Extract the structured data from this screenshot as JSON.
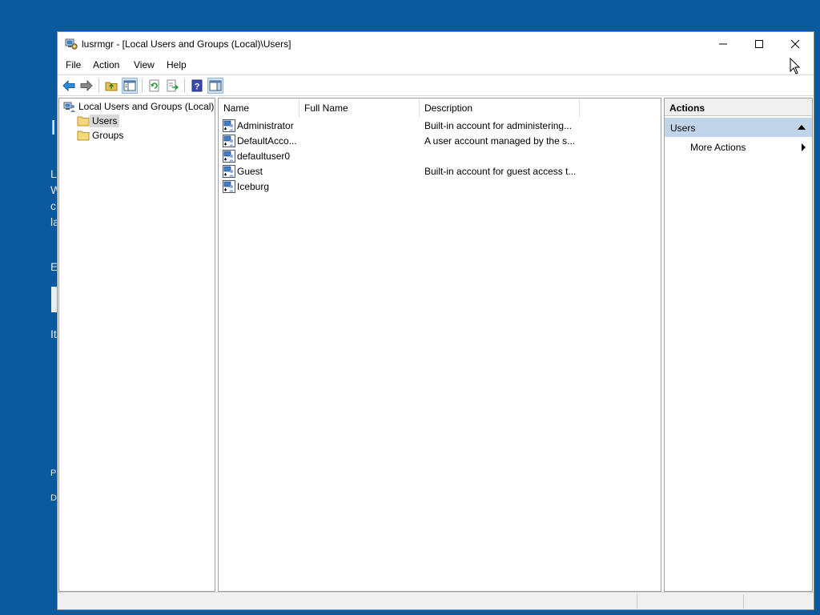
{
  "background": {
    "fragments": [
      "I",
      "L",
      "W",
      "c",
      "la",
      "E",
      "It",
      "P",
      "D"
    ]
  },
  "window": {
    "title": "lusrmgr - [Local Users and Groups (Local)\\Users]",
    "controls": {
      "minimize": "minimize",
      "maximize": "maximize",
      "close": "close"
    }
  },
  "menu": {
    "items": [
      "File",
      "Action",
      "View",
      "Help"
    ]
  },
  "toolbar": {
    "buttons": [
      "back-arrow-icon",
      "forward-arrow-icon",
      "up-folder-icon",
      "show-hide-tree-icon",
      "refresh-icon",
      "export-list-icon",
      "help-icon",
      "show-hide-action-pane-icon"
    ]
  },
  "tree": {
    "root": "Local Users and Groups (Local)",
    "children": [
      "Users",
      "Groups"
    ],
    "selected": "Users"
  },
  "list": {
    "columns": [
      "Name",
      "Full Name",
      "Description"
    ],
    "rows": [
      {
        "name": "Administrator",
        "full_name": "",
        "description": "Built-in account for administering..."
      },
      {
        "name": "DefaultAcco...",
        "full_name": "",
        "description": "A user account managed by the s..."
      },
      {
        "name": "defaultuser0",
        "full_name": "",
        "description": ""
      },
      {
        "name": "Guest",
        "full_name": "",
        "description": "Built-in account for guest access t..."
      },
      {
        "name": "Iceburg",
        "full_name": "",
        "description": ""
      }
    ]
  },
  "actions": {
    "header": "Actions",
    "section": "Users",
    "items": [
      "More Actions"
    ]
  },
  "colors": {
    "desktop": "#0b5aa0",
    "selection": "#d9d9d9",
    "actions_section": "#c0d4ea"
  }
}
